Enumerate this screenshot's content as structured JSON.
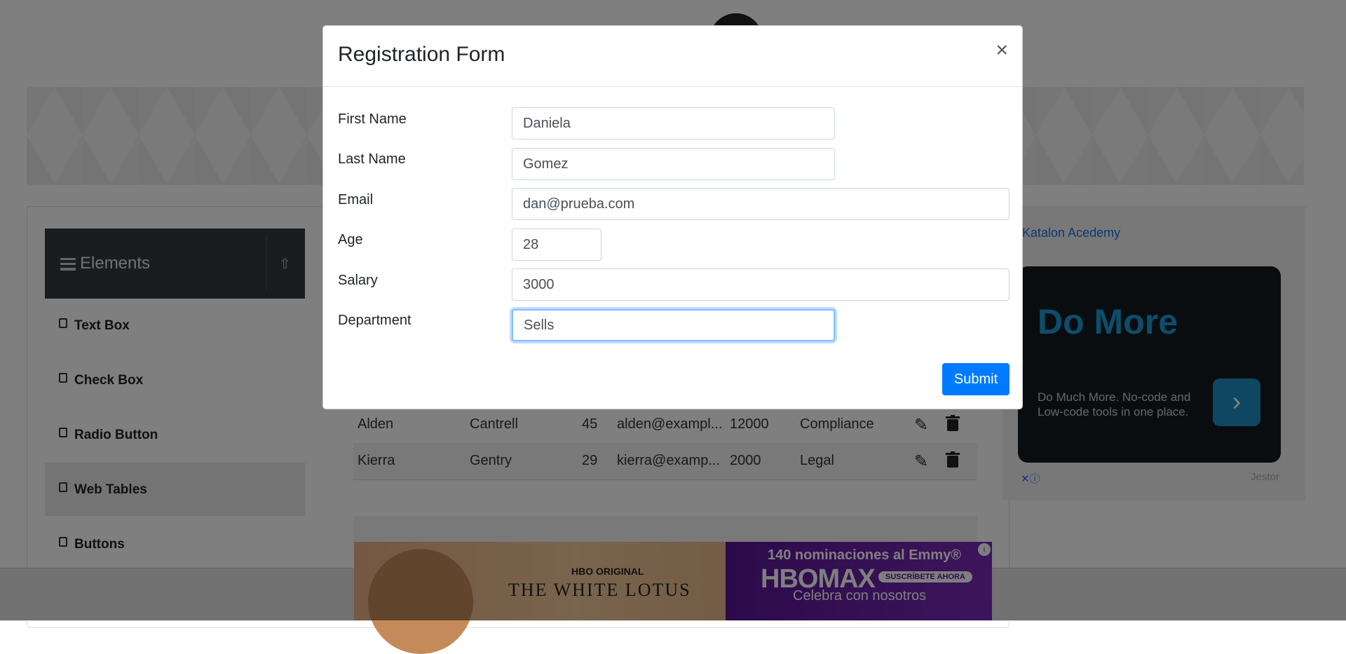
{
  "elements_group": {
    "title": "Elements",
    "items": [
      {
        "label": "Text Box"
      },
      {
        "label": "Check Box"
      },
      {
        "label": "Radio Button"
      },
      {
        "label": "Web Tables"
      },
      {
        "label": "Buttons"
      }
    ]
  },
  "table": {
    "rows": [
      {
        "first": "Alden",
        "last": "Cantrell",
        "age": "45",
        "email": "alden@exampl...",
        "salary": "12000",
        "department": "Compliance"
      },
      {
        "first": "Kierra",
        "last": "Gentry",
        "age": "29",
        "email": "kierra@examp...",
        "salary": "2000",
        "department": "Legal"
      }
    ]
  },
  "ad_right": {
    "link_text": "Katalon Acedemy",
    "headline": "Do More",
    "body": "Do Much More. No-code and Low-code tools in one place.",
    "footer_brand": "Jestor"
  },
  "ad_bottom": {
    "hbo_original": "HBO ORIGINAL",
    "show": "THE WHITE LOTUS",
    "nominations": "140 nominaciones al Emmy®",
    "brand": "HBOMAX",
    "cta": "SUSCRÍBETE AHORA",
    "tagline": "Celebra con nosotros"
  },
  "modal": {
    "title": "Registration Form",
    "close_symbol": "×",
    "fields": {
      "first_name": {
        "label": "First Name",
        "value": "Daniela"
      },
      "last_name": {
        "label": "Last Name",
        "value": "Gomez"
      },
      "email": {
        "label": "Email",
        "value": "dan@prueba.com"
      },
      "age": {
        "label": "Age",
        "value": "28"
      },
      "salary": {
        "label": "Salary",
        "value": "3000"
      },
      "department": {
        "label": "Department",
        "value": "Sells"
      }
    },
    "submit_label": "Submit"
  }
}
